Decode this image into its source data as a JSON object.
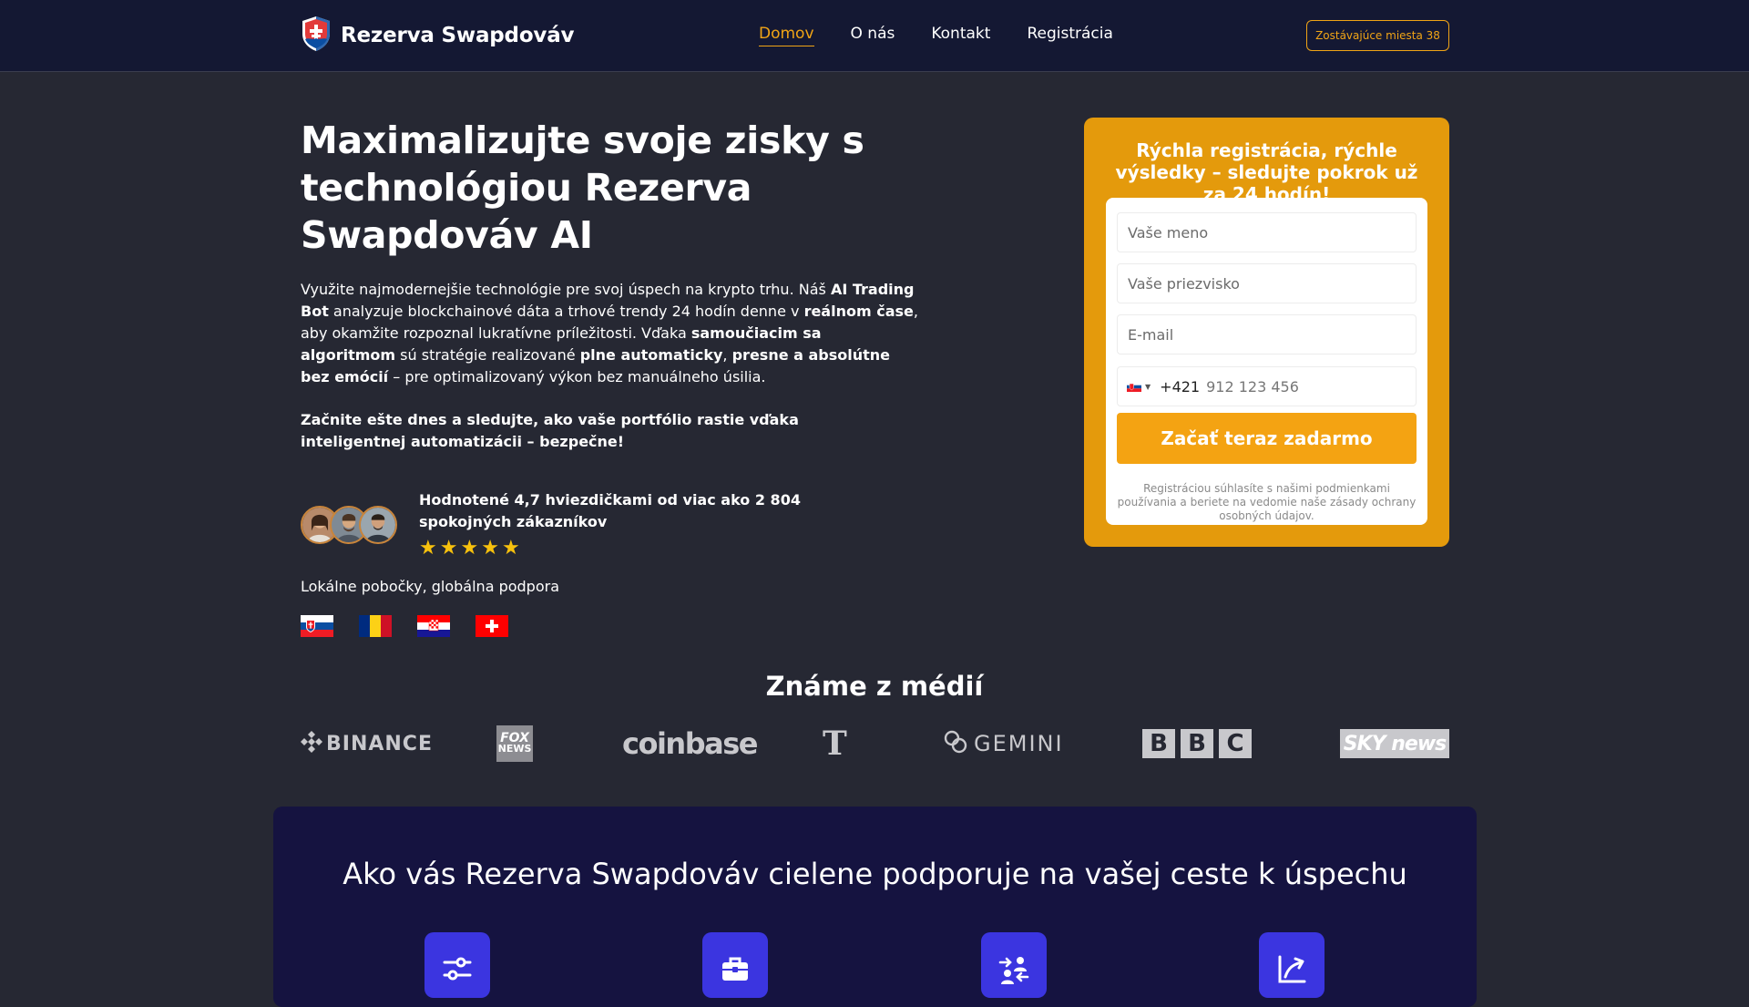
{
  "header": {
    "brand": "Rezerva Swapdováv",
    "nav": [
      "Domov",
      "O nás",
      "Kontakt",
      "Registrácia"
    ],
    "seats_button": "Zostávajúce miesta 38"
  },
  "hero": {
    "title": "Maximalizujte svoje zisky s technológiou Rezerva Swapdováv AI",
    "p1": "Využite najmodernejšie technológie pre svoj úspech na krypto trhu. Náš ",
    "b1": "AI Trading Bot",
    "p2": " analyzuje blockchainové dáta a trhové trendy 24 hodín denne v ",
    "b2": "reálnom čase",
    "p3": ", aby okamžite rozpoznal lukratívne príležitosti. Vďaka ",
    "b3": "samoučiacim sa algoritmom",
    "p4": " sú stratégie realizované ",
    "b4": "plne automaticky",
    "p5": ", ",
    "b5": "presne a absolútne bez emócií",
    "p6": " – pre optimalizovaný výkon bez manuálneho úsilia.",
    "cta_text": "Začnite ešte dnes a sledujte, ako vaše portfólio rastie vďaka inteligentnej automatizácii – bezpečne!",
    "rating_text": "Hodnotené 4,7 hviezdičkami od viac ako 2 804 spokojných zákazníkov",
    "stars": "★",
    "rating_value": 5,
    "local_text": "Lokálne pobočky, globálna podpora"
  },
  "form": {
    "heading": "Rýchla registrácia, rýchle výsledky – sledujte pokrok už za 24 hodín!",
    "first_name_placeholder": "Vaše meno",
    "last_name_placeholder": "Vaše priezvisko",
    "email_placeholder": "E-mail",
    "phone_code": "+421",
    "phone_placeholder": "912 123 456",
    "submit_label": "Začať teraz zadarmo",
    "disclaimer": "Registráciou súhlasíte s našimi podmienkami používania a beriete na vedomie naše zásady ochrany osobných údajov."
  },
  "media": {
    "title": "Známe z médií",
    "binance": "BINANCE",
    "fox_top": "FOX",
    "fox_bottom": "NEWS",
    "coinbase": "coinbase",
    "nyt": "T",
    "gemini": "GEMINI",
    "bbc": [
      "B",
      "B",
      "C"
    ],
    "skynews": "SKY news"
  },
  "features": {
    "title": "Ako vás Rezerva Swapdováv cielene podporuje na vašej ceste k úspechu"
  },
  "colors": {
    "accent": "#f0a416",
    "header_bg": "#141833",
    "page_bg": "#262833",
    "feature_bg": "#151340",
    "feature_icon_bg": "#3b35e0"
  }
}
